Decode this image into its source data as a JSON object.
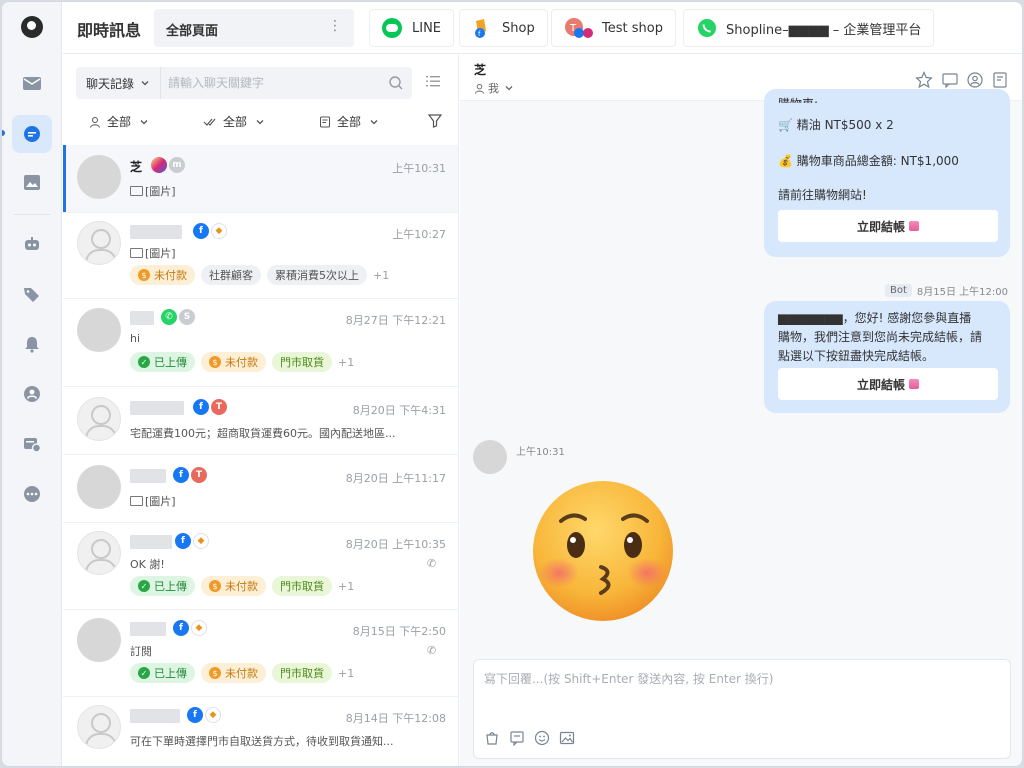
{
  "app": {
    "title": "即時訊息",
    "pages_select": "全部頁面"
  },
  "channels": [
    {
      "label": "LINE",
      "icon": "line-icon"
    },
    {
      "label": "Shop",
      "icon": "shop-icon"
    },
    {
      "label": "Test shop",
      "icon": "test-shop-icon"
    },
    {
      "label": "Shopline–▆▆▆▆ – 企業管理平台",
      "icon": "whatsapp-icon"
    }
  ],
  "rail": [
    {
      "name": "inbox-icon"
    },
    {
      "name": "chat-icon",
      "active": true
    },
    {
      "name": "image-icon"
    },
    {
      "name": "bot-icon"
    },
    {
      "name": "tag-icon"
    },
    {
      "name": "bell-icon"
    },
    {
      "name": "contact-icon"
    },
    {
      "name": "broadcast-icon"
    },
    {
      "name": "more-icon"
    }
  ],
  "list": {
    "mode": "聊天記錄",
    "search_placeholder": "請輸入聊天關鍵字",
    "filters": [
      "全部",
      "全部",
      "全部"
    ]
  },
  "conversations": [
    {
      "name": "芝",
      "badges": [
        "ig",
        "grey"
      ],
      "time": "上午10:31",
      "msg": "[圖片]",
      "img": true,
      "tags": []
    },
    {
      "name": "",
      "badges": [
        "fb",
        "shop"
      ],
      "time": "上午10:27",
      "msg": "[圖片]",
      "img": true,
      "tags": [
        {
          "t": "未付款",
          "k": "unpaid"
        },
        {
          "t": "社群顧客",
          "k": "grey"
        },
        {
          "t": "累積消費5次以上",
          "k": "grey"
        }
      ],
      "more": "+1"
    },
    {
      "name": "",
      "badges": [
        "wa",
        "grey"
      ],
      "time": "8月27日 下午12:21",
      "msg": "hi",
      "tags": [
        {
          "t": "已上傳",
          "k": "uploaded"
        },
        {
          "t": "未付款",
          "k": "unpaid"
        },
        {
          "t": "門市取貨",
          "k": "store"
        }
      ],
      "more": "+1"
    },
    {
      "name": "",
      "badges": [
        "fb",
        "red"
      ],
      "time": "8月20日 下午4:31",
      "msg": "宅配運費100元；超商取貨運費60元。國內配送地區...",
      "tags": []
    },
    {
      "name": "",
      "badges": [
        "fb",
        "red"
      ],
      "time": "8月20日 上午11:17",
      "msg": "[圖片]",
      "img": true,
      "tags": []
    },
    {
      "name": "",
      "badges": [
        "fb",
        "shop"
      ],
      "time": "8月20日 上午10:35",
      "msg": "OK 謝!",
      "phone": true,
      "tags": [
        {
          "t": "已上傳",
          "k": "uploaded"
        },
        {
          "t": "未付款",
          "k": "unpaid"
        },
        {
          "t": "門市取貨",
          "k": "store"
        }
      ],
      "more": "+1"
    },
    {
      "name": "",
      "badges": [
        "fb",
        "shop"
      ],
      "time": "8月15日 下午2:50",
      "msg": "訂閱",
      "phone": true,
      "tags": [
        {
          "t": "已上傳",
          "k": "uploaded"
        },
        {
          "t": "未付款",
          "k": "unpaid"
        },
        {
          "t": "門市取貨",
          "k": "store"
        }
      ],
      "more": "+1"
    },
    {
      "name": "",
      "badges": [
        "fb",
        "shop"
      ],
      "time": "8月14日 下午12:08",
      "msg": "可在下單時選擇門市自取送貨方式，待收到取貨通知...",
      "tags": []
    }
  ],
  "chat": {
    "contact_name": "芝",
    "assignee": "我",
    "msg1": {
      "lines": [
        "購物車:",
        "🛒 精油 NT$500 x 2",
        "",
        "💰 購物車商品總金額: NT$1,000",
        "",
        "請前往購物網站!"
      ],
      "button": "立即結帳"
    },
    "msg2": {
      "bot_label": "Bot",
      "time": "8月15日 上午12:00",
      "lines": [
        "▆▆▆▆▆▆▆，您好! 感謝您參與直播",
        "購物，我們注意到您尚未完成結帳，請",
        "點選以下按鈕盡快完成結帳。"
      ],
      "button": "立即結帳"
    },
    "incoming_time": "上午10:31",
    "composer_placeholder": "寫下回覆...(按 Shift+Enter 發送內容, 按 Enter 換行)"
  }
}
